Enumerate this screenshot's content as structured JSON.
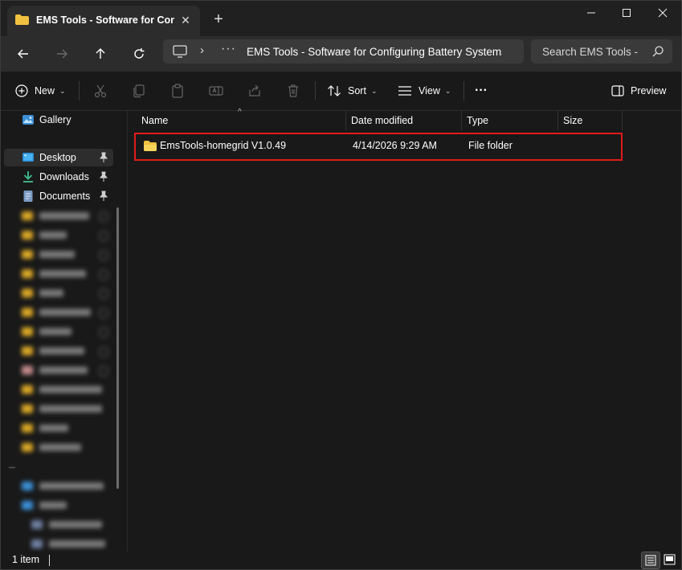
{
  "tab": {
    "title": "EMS Tools - Software for Configuring Battery Systems",
    "close_icon": "close-icon",
    "new_tab_icon": "plus-icon"
  },
  "window_controls": [
    "minimize-icon",
    "maximize-icon",
    "close-icon"
  ],
  "nav": {
    "back_icon": "arrow-left-icon",
    "forward_icon": "arrow-right-icon",
    "up_icon": "arrow-up-icon",
    "refresh_icon": "refresh-icon"
  },
  "address": {
    "path_text": "EMS Tools - Software for Configuring Battery Systems",
    "more_label": "···",
    "separator": "›"
  },
  "search": {
    "placeholder": "Search EMS Tools - "
  },
  "commands": {
    "new_label": "New",
    "sort_label": "Sort",
    "view_label": "View",
    "more_label": "···",
    "preview_label": "Preview"
  },
  "sidebar": {
    "gallery_label": "Gallery",
    "pinned": [
      {
        "label": "Desktop",
        "icon": "desktop-icon",
        "selected": true
      },
      {
        "label": "Downloads",
        "icon": "download-icon",
        "selected": false
      },
      {
        "label": "Documents",
        "icon": "document-icon",
        "selected": false
      }
    ]
  },
  "columns": {
    "name": "Name",
    "date": "Date modified",
    "type": "Type",
    "size": "Size"
  },
  "files": [
    {
      "name": "EmsTools-homegrid V1.0.49",
      "date": "4/14/2026 9:29 AM",
      "type": "File folder",
      "size": "",
      "icon": "folder-icon"
    }
  ],
  "status": {
    "count": "1 item"
  },
  "colors": {
    "background": "#191919",
    "highlight_border": "#e01b1b",
    "folder": "#f0c040",
    "accent": "#4cc2ff"
  }
}
